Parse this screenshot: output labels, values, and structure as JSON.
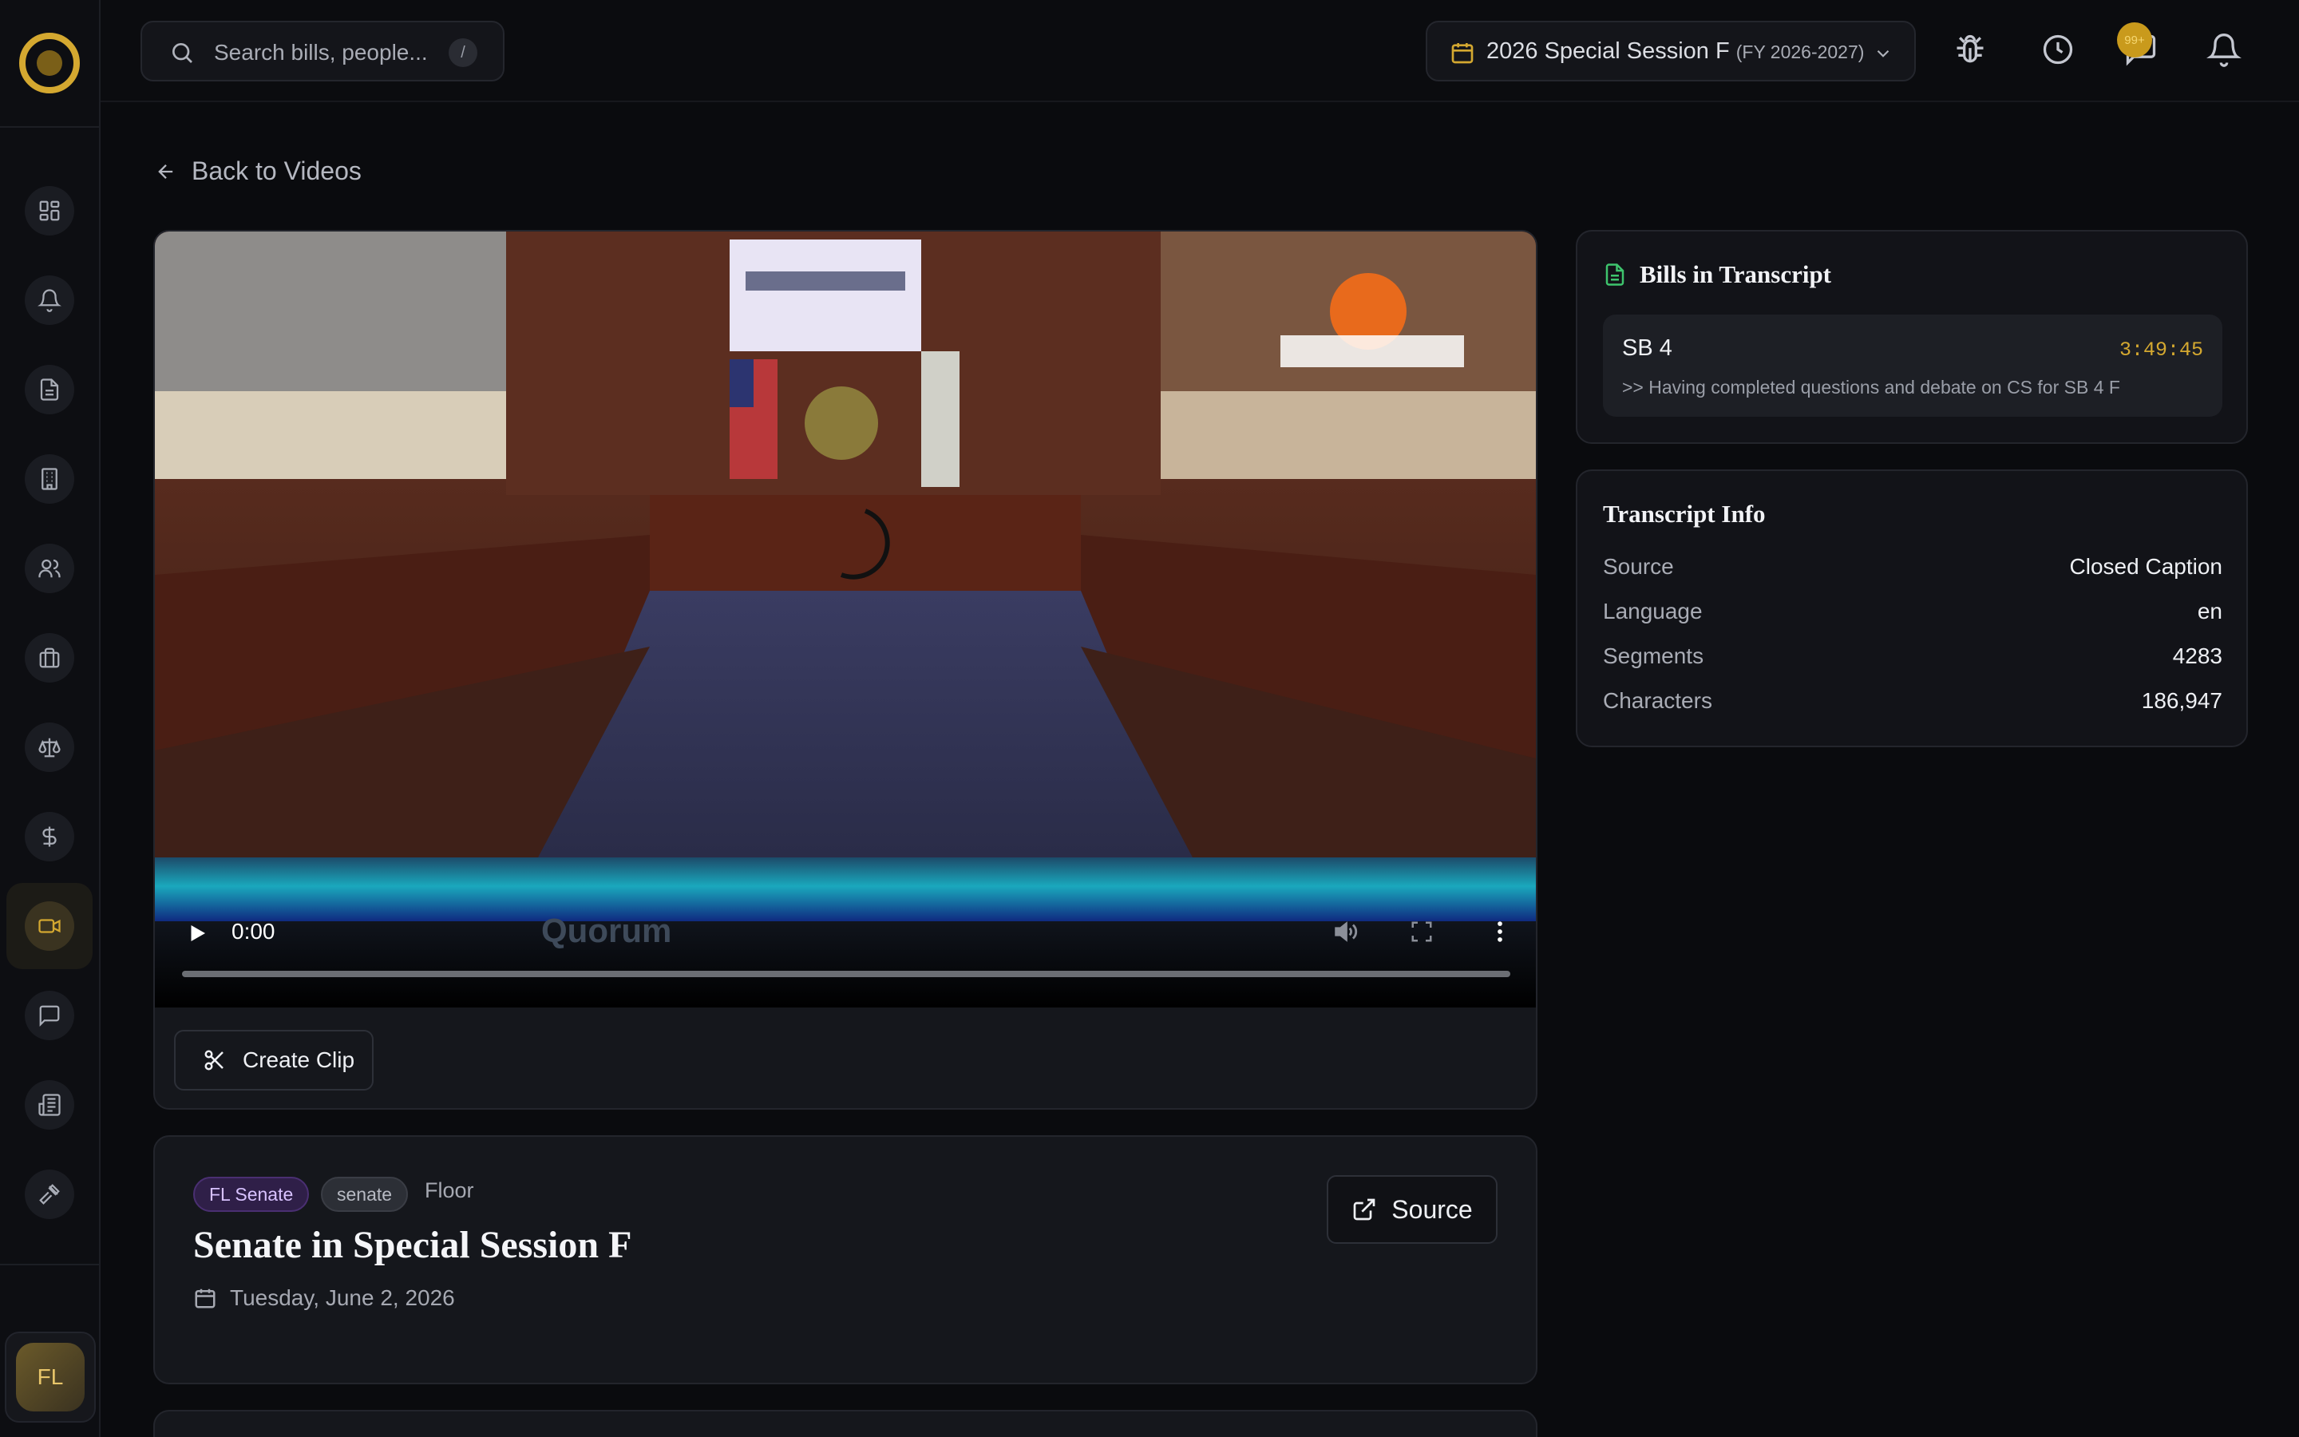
{
  "topbar": {
    "search_placeholder": "Search bills, people...",
    "search_shortcut": "/",
    "session_label": "2026 Special Session F",
    "session_fy": "(FY 2026-2027)",
    "notification_count": "99+"
  },
  "sidebar": {
    "items": [
      {
        "name": "dashboard-icon"
      },
      {
        "name": "bell-icon"
      },
      {
        "name": "document-icon"
      },
      {
        "name": "building-icon"
      },
      {
        "name": "people-icon"
      },
      {
        "name": "briefcase-icon"
      },
      {
        "name": "scales-icon"
      },
      {
        "name": "dollar-icon"
      },
      {
        "name": "video-icon",
        "active": true
      },
      {
        "name": "chat-icon"
      },
      {
        "name": "newspaper-icon"
      },
      {
        "name": "gavel-icon"
      }
    ],
    "user_initials": "FL"
  },
  "page": {
    "back_label": "Back to Videos",
    "video": {
      "time": "0:00",
      "watermark": "Quorum"
    },
    "create_clip_label": "Create Clip",
    "tags": [
      "FL Senate",
      "senate"
    ],
    "category": "Floor",
    "title": "Senate in Special Session F",
    "date": "Tuesday, June 2, 2026",
    "source_label": "Source"
  },
  "bills_panel": {
    "title": "Bills in Transcript",
    "items": [
      {
        "bill": "SB 4",
        "time": "3:49:45",
        "snippet": ">> Having completed questions and debate on CS for SB 4 F"
      }
    ]
  },
  "transcript_info": {
    "title": "Transcript Info",
    "rows": [
      {
        "key": "Source",
        "value": "Closed Caption"
      },
      {
        "key": "Language",
        "value": "en"
      },
      {
        "key": "Segments",
        "value": "4283"
      },
      {
        "key": "Characters",
        "value": "186,947"
      }
    ]
  },
  "colors": {
    "accent": "#d4a830",
    "success": "#3ec46d",
    "background": "#0a0b0e",
    "card": "#15171c"
  }
}
